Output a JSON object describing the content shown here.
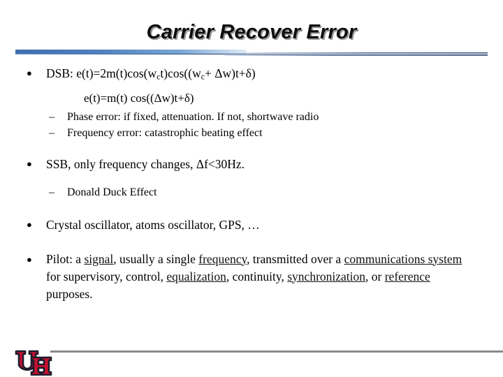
{
  "slide": {
    "title": "Carrier Recover Error",
    "bullets": {
      "dsb_prefix": "DSB: e(t)=2m(t)cos(w",
      "dsb_sub1": "c",
      "dsb_mid": "t)cos((w",
      "dsb_sub2": "c",
      "dsb_suffix": "+ Δw)t+δ)",
      "formula_line": "e(t)=m(t) cos((Δw)t+δ)",
      "phase_error": "Phase error: if fixed, attenuation. If not, shortwave radio",
      "frequency_error": "Frequency error: catastrophic beating effect",
      "ssb": "SSB, only frequency changes, Δf<30Hz.",
      "donald_duck": "Donald Duck Effect",
      "oscillators": "Crystal oscillator, atoms oscillator, GPS, …"
    },
    "pilot": {
      "p1": "Pilot: a ",
      "link_signal": "signal",
      "p2": ", usually a single ",
      "link_frequency": "frequency",
      "p3": ", transmitted over a ",
      "link_comm_system": "communications system",
      "p4": " for supervisory, control, ",
      "link_equalization": "equalization",
      "p5": ", continuity, ",
      "link_synchronization": "synchronization",
      "p6": ", or ",
      "link_reference": "reference",
      "p7": " purposes."
    },
    "markers": {
      "bullet": "●",
      "dash": "–"
    },
    "footer": {
      "logo_alt": "UH"
    },
    "colors": {
      "accent_blue": "#4d81bd",
      "rule_navy": "#16305f",
      "footer_gray": "#8a8a8a",
      "uh_red": "#c8102e",
      "uh_outline": "#1d1d2e"
    }
  }
}
